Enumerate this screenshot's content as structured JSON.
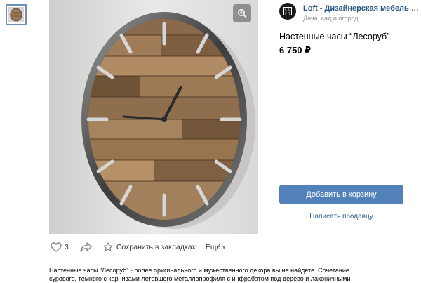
{
  "shop": {
    "name": "Loft - Дизайнерская мебель на ...",
    "category": "Дача, сад и огород"
  },
  "product": {
    "title": "Настенные часы “Лесоруб”",
    "price": "6 750 ₽"
  },
  "buttons": {
    "add_to_cart": "Добавить в корзину",
    "message_seller": "Написать продавцу"
  },
  "actions": {
    "like_count": "3",
    "bookmark": "Сохранить в закладках",
    "more": "Ещё"
  },
  "description": {
    "line1": "Настенные часы “Лесоруб” - более оригинального и мужественного декора вы не найдете. Сочетание",
    "line2": "сурового, темного с карнизами летевшего металлопрофиля с инфрабатом под дерево и лаконичными"
  },
  "icons": {
    "zoom": "zoom-in-icon",
    "like": "heart-icon",
    "share": "share-arrow-icon",
    "bookmark": "star-icon",
    "more": "chevron-down-icon"
  },
  "colors": {
    "accent": "#5181b8",
    "link": "#2a5885",
    "muted": "#939393",
    "thumb_border": "#6f8fb8"
  }
}
